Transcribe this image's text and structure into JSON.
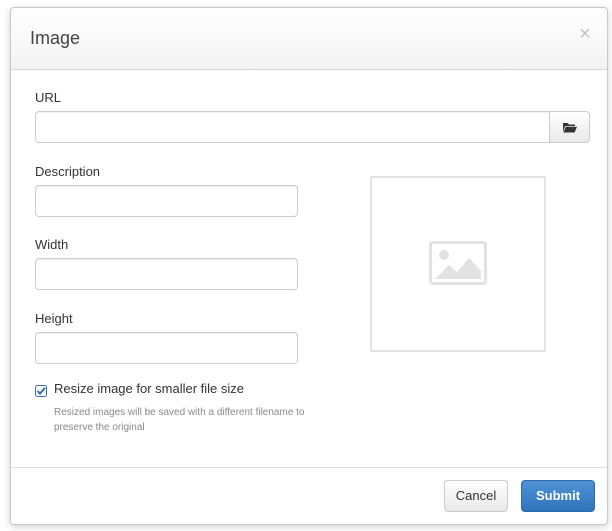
{
  "dialog": {
    "title": "Image",
    "close_symbol": "×",
    "close_icon": "close-icon"
  },
  "form": {
    "url": {
      "label": "URL",
      "value": "",
      "browse_icon": "folder-open-icon"
    },
    "description": {
      "label": "Description",
      "value": ""
    },
    "width": {
      "label": "Width",
      "value": ""
    },
    "height": {
      "label": "Height",
      "value": ""
    },
    "resize": {
      "checked": true,
      "label": "Resize image for smaller file size",
      "help": "Resized images will be saved with a different filename to preserve the original"
    }
  },
  "preview": {
    "icon": "image-placeholder-icon"
  },
  "footer": {
    "cancel_label": "Cancel",
    "submit_label": "Submit"
  },
  "colors": {
    "primary": "#3a80c7",
    "checkbox": "#3a6fad"
  }
}
